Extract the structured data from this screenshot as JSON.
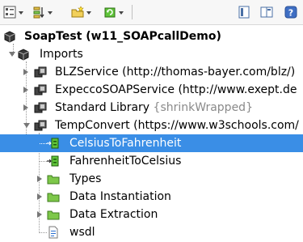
{
  "toolbar": {
    "buttons": [
      {
        "icon": "tree-view-icon",
        "has_dropdown": true
      },
      {
        "icon": "sort-icon",
        "has_dropdown": true
      },
      {
        "icon": "folder-new-icon",
        "has_dropdown": true
      },
      {
        "icon": "refresh-package-icon",
        "has_dropdown": true
      }
    ],
    "right_buttons": [
      {
        "icon": "collapse-panel-icon"
      },
      {
        "icon": "split-panel-icon"
      },
      {
        "icon": "help-icon",
        "glyph": "?"
      }
    ]
  },
  "tree": {
    "root": {
      "label": "SoapTest (w11_SOAPcallDemo)"
    },
    "imports": {
      "label": "Imports"
    },
    "import_items": [
      {
        "label": "BLZService (http://thomas-bayer.com/blz/)",
        "suffix": ""
      },
      {
        "label": "ExpeccoSOAPService (http://www.exept.de",
        "suffix": ""
      },
      {
        "label": "Standard Library ",
        "suffix": "{shrinkWrapped}"
      },
      {
        "label": "TempConvert (https://www.w3schools.com/",
        "suffix": ""
      }
    ],
    "children": [
      {
        "label": "CelsiusToFahrenheit",
        "selected": true
      },
      {
        "label": "FahrenheitToCelsius",
        "selected": false
      },
      {
        "label": "Types"
      },
      {
        "label": "Data Instantiation"
      },
      {
        "label": "Data Extraction"
      },
      {
        "label": "wsdl"
      }
    ]
  },
  "colors": {
    "selection": "#3a8ee6",
    "folder_green": "#7ec84a",
    "package_dark": "#3a3a3a",
    "shrinkwrapped_grey": "#8a8a8a"
  }
}
